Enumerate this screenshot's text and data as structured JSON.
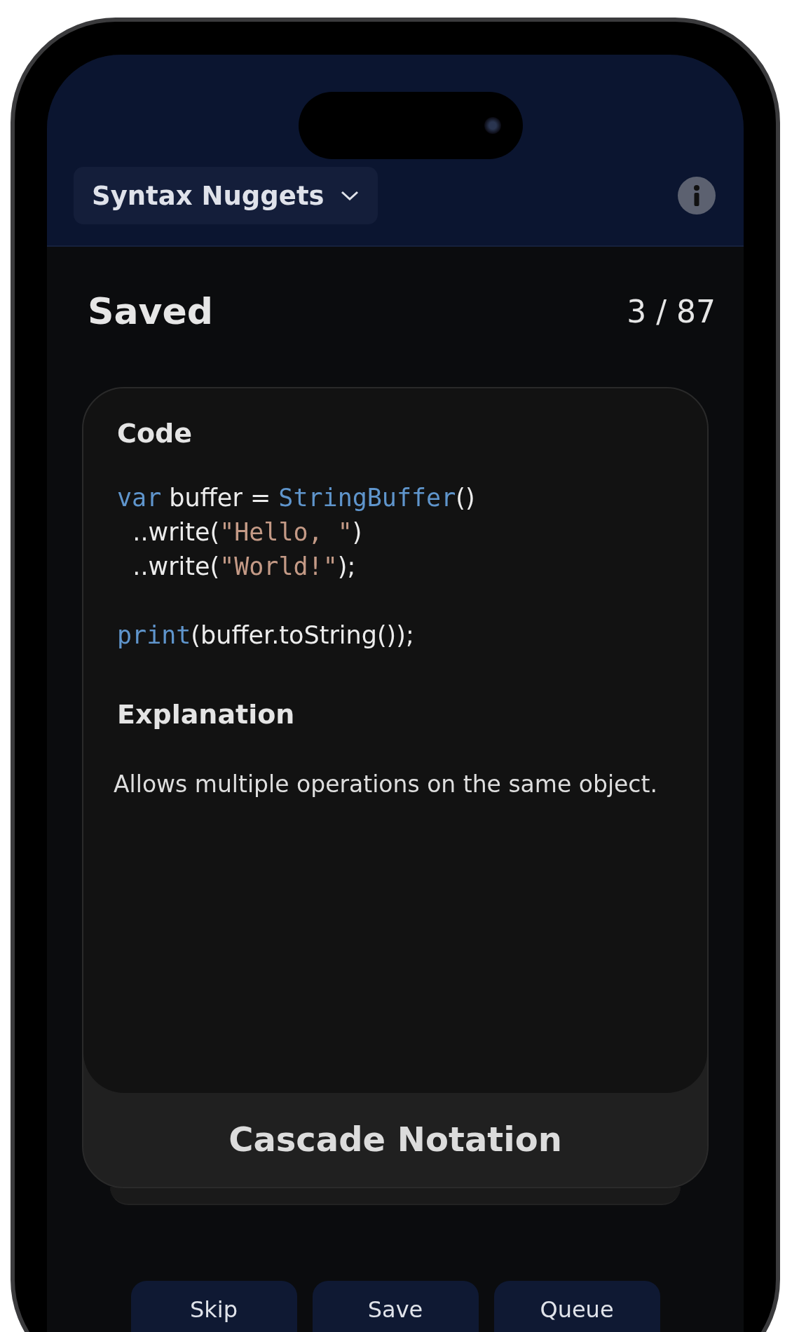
{
  "header": {
    "deck_selector": "Syntax Nuggets"
  },
  "list": {
    "title": "Saved",
    "counter": "3 / 87"
  },
  "card": {
    "code_heading": "Code",
    "code_lines": [
      [
        {
          "kind": "keyword",
          "text": "var"
        },
        {
          "kind": "plain",
          "text": " buffer = "
        },
        {
          "kind": "type",
          "text": "StringBuffer"
        },
        {
          "kind": "plain",
          "text": "()"
        }
      ],
      [
        {
          "kind": "plain",
          "text": "  ..write("
        },
        {
          "kind": "string",
          "text": "\"Hello, \""
        },
        {
          "kind": "plain",
          "text": ")"
        }
      ],
      [
        {
          "kind": "plain",
          "text": "  ..write("
        },
        {
          "kind": "string",
          "text": "\"World!\""
        },
        {
          "kind": "plain",
          "text": ");"
        }
      ],
      {
        "kind": "blank"
      },
      [
        {
          "kind": "keyword",
          "text": "print"
        },
        {
          "kind": "plain",
          "text": "(buffer.toString());"
        }
      ]
    ],
    "explanation_heading": "Explanation",
    "explanation": "Allows multiple operations on the same object.",
    "title": "Cascade Notation"
  },
  "buttons": [
    "Skip",
    "Save",
    "Queue"
  ]
}
